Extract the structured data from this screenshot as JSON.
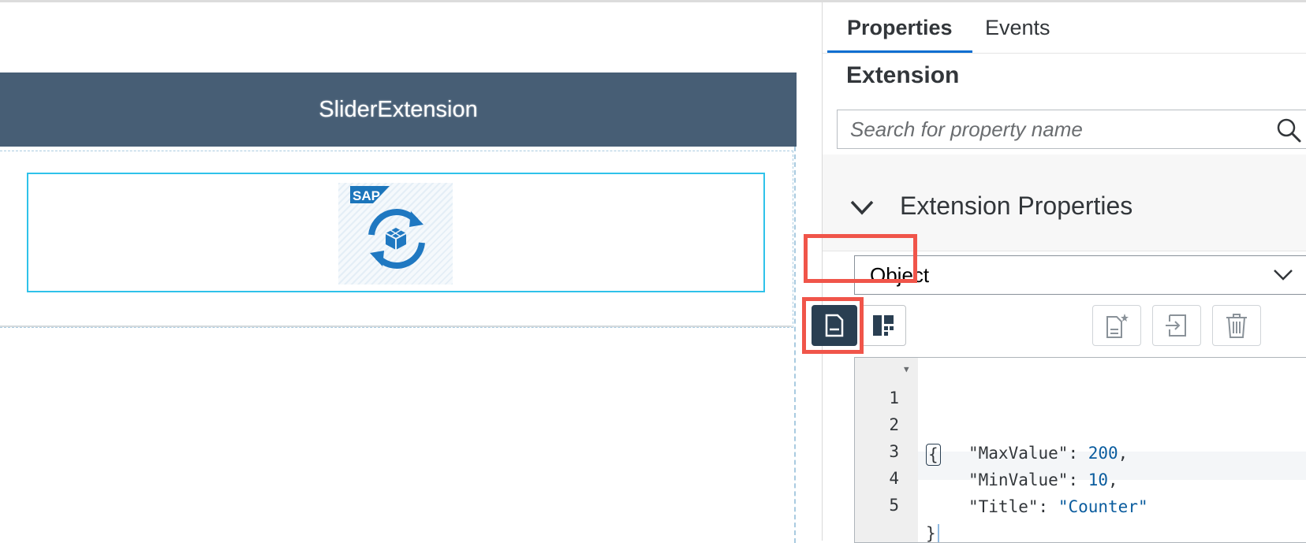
{
  "canvas": {
    "header_title": "SliderExtension",
    "extension_logo_text": "SAP"
  },
  "panel": {
    "tabs": [
      {
        "label": "Properties",
        "active": true
      },
      {
        "label": "Events",
        "active": false
      }
    ],
    "section_title": "Extension",
    "search": {
      "placeholder": "Search for property name",
      "value": ""
    },
    "group": {
      "title": "Extension Properties",
      "expanded": true
    },
    "type_select": {
      "value": "Object"
    },
    "editor_modes": [
      {
        "name": "code-mode",
        "icon": "document-icon",
        "active": true
      },
      {
        "name": "form-mode",
        "icon": "layout-icon",
        "active": false
      }
    ],
    "editor_actions": [
      {
        "name": "new-document",
        "icon": "document-star-icon"
      },
      {
        "name": "import",
        "icon": "import-icon"
      },
      {
        "name": "delete",
        "icon": "trash-icon"
      }
    ],
    "code": {
      "lines": [
        {
          "num": "1",
          "text": "{"
        },
        {
          "num": "2",
          "key": "\"MaxValue\"",
          "sep": ": ",
          "value": "200",
          "end": ","
        },
        {
          "num": "3",
          "key": "\"MinValue\"",
          "sep": ": ",
          "value": "10",
          "end": ","
        },
        {
          "num": "4",
          "key": "\"Title\"",
          "sep": ": ",
          "value": "\"Counter\"",
          "end": ""
        },
        {
          "num": "5",
          "text": "}"
        }
      ]
    }
  },
  "colors": {
    "header_bg": "#475e75",
    "accent": "#0a6ed1",
    "highlight_border": "#f0554a",
    "active_button": "#2a3f52",
    "selection_border": "#2fc2ea"
  }
}
